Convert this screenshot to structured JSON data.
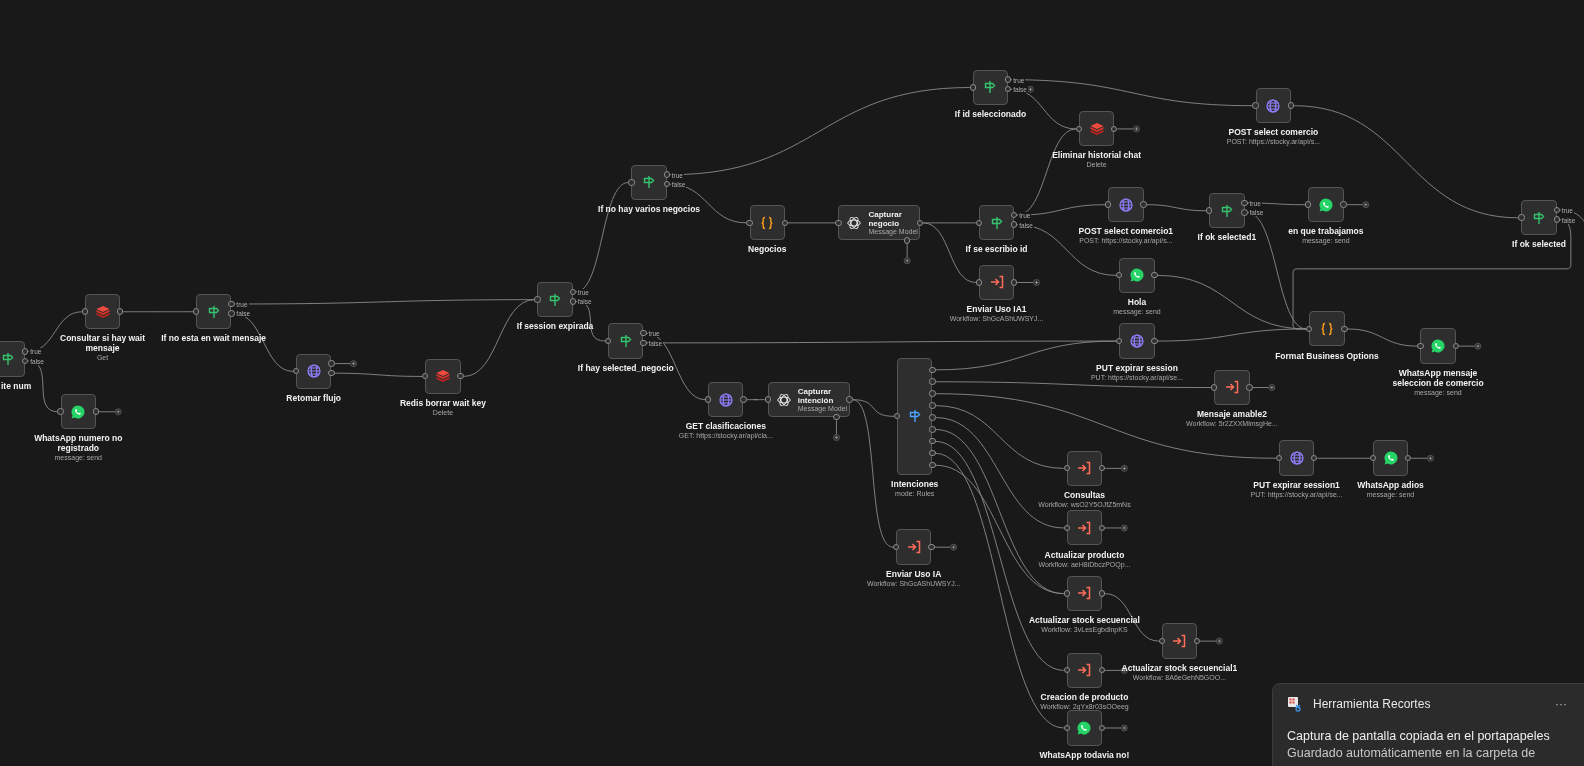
{
  "canvas": {
    "nodes": [
      {
        "kind": "if",
        "title": "ite num",
        "outputs": [
          "true",
          "false"
        ]
      },
      {
        "kind": "redis",
        "title": "Consultar si hay wait mensaje",
        "subtitle": "Get"
      },
      {
        "kind": "whatsapp",
        "title": "WhatsApp numero no registrado",
        "subtitle": "message: send"
      },
      {
        "kind": "if",
        "title": "If no esta en wait mensaje",
        "outputs": [
          "true",
          "false"
        ]
      },
      {
        "kind": "http",
        "title": "Retomar flujo"
      },
      {
        "kind": "redis",
        "title": "Redis borrar wait key",
        "subtitle": "Delete"
      },
      {
        "kind": "if",
        "title": "If session expirada",
        "outputs": [
          "true",
          "false"
        ]
      },
      {
        "kind": "if",
        "title": "If no hay varios negocios",
        "outputs": [
          "true",
          "false"
        ]
      },
      {
        "kind": "if",
        "title": "If hay selected_negocio",
        "outputs": [
          "true",
          "false"
        ]
      },
      {
        "kind": "code",
        "title": "Negocios"
      },
      {
        "kind": "ai",
        "title": "Capturar negocio",
        "subtitle": "Message Model"
      },
      {
        "kind": "if",
        "title": "If id seleccionado",
        "outputs": [
          "true",
          "false"
        ]
      },
      {
        "kind": "if",
        "title": "If se escribio id",
        "outputs": [
          "true",
          "false"
        ]
      },
      {
        "kind": "workflow",
        "title": "Enviar Uso IA1",
        "subtitle": "Workflow: ShGcAShUWSYJ..."
      },
      {
        "kind": "redis",
        "title": "Eliminar historial chat",
        "subtitle": "Delete"
      },
      {
        "kind": "http",
        "title": "POST select comercio",
        "subtitle": "POST: https://stocky.ar/api/s..."
      },
      {
        "kind": "http",
        "title": "POST select comercio1",
        "subtitle": "POST: https://stocky.ar/api/s..."
      },
      {
        "kind": "if",
        "title": "If ok selected1",
        "outputs": [
          "true",
          "false"
        ]
      },
      {
        "kind": "whatsapp",
        "title": "en que trabajamos",
        "subtitle": "message: send"
      },
      {
        "kind": "if",
        "title": "If ok selected",
        "outputs": [
          "true",
          "false"
        ]
      },
      {
        "kind": "whatsapp",
        "title": "Hola",
        "subtitle": "message: send"
      },
      {
        "kind": "http",
        "title": "PUT expirar session",
        "subtitle": "PUT: https://stocky.ar/api/se..."
      },
      {
        "kind": "code",
        "title": "Format Business Options"
      },
      {
        "kind": "whatsapp",
        "title": "WhatsApp mensaje seleccion de comercio",
        "subtitle": "message: send"
      },
      {
        "kind": "http",
        "title": "GET clasificaciones",
        "subtitle": "GET: https://stocky.ar/api/cla..."
      },
      {
        "kind": "ai",
        "title": "Capturar intención",
        "subtitle": "Message Model"
      },
      {
        "kind": "switch",
        "title": "Intenciones",
        "subtitle": "mode: Rules"
      },
      {
        "kind": "workflow",
        "title": "Mensaje amable2",
        "subtitle": "Workflow: 5r2ZXXMlmsgHe..."
      },
      {
        "kind": "http",
        "title": "PUT expirar session1",
        "subtitle": "PUT: https://stocky.ar/api/se..."
      },
      {
        "kind": "whatsapp",
        "title": "WhatsApp adios",
        "subtitle": "message: send"
      },
      {
        "kind": "workflow",
        "title": "Consultas",
        "subtitle": "Workflow: wsO2Y5OJfZ5mNs"
      },
      {
        "kind": "workflow",
        "title": "Actualizar producto",
        "subtitle": "Workflow: aeH8iDbczPOQp..."
      },
      {
        "kind": "workflow",
        "title": "Enviar Uso IA",
        "subtitle": "Workflow: ShGcAShUWSYJ..."
      },
      {
        "kind": "workflow",
        "title": "Actualizar stock secuencial",
        "subtitle": "Workflow: 3vLesEgbdlnpKS"
      },
      {
        "kind": "workflow",
        "title": "Actualizar stock secuencial1",
        "subtitle": "Workflow: 8A6eGehN5GOO..."
      },
      {
        "kind": "workflow",
        "title": "Creacion de producto",
        "subtitle": "Workflow: 2qYx8r03sOOeeg"
      },
      {
        "kind": "whatsapp",
        "title": "WhatsApp todavia no!"
      }
    ]
  },
  "notification": {
    "app": "Herramienta Recortes",
    "menu": "···",
    "title": "Captura de pantalla copiada en el portapapeles",
    "body": "Guardado automáticamente en la carpeta de"
  }
}
